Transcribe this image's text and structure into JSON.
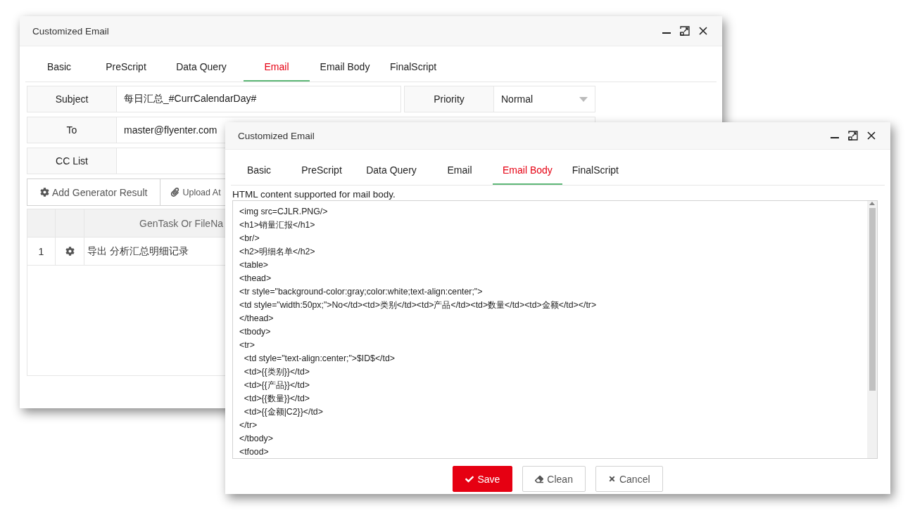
{
  "back_window": {
    "title": "Customized Email",
    "tabs": [
      {
        "label": "Basic",
        "selected": false
      },
      {
        "label": "PreScript",
        "selected": false
      },
      {
        "label": "Data Query",
        "selected": false
      },
      {
        "label": "Email",
        "selected": true
      },
      {
        "label": "Email Body",
        "selected": false
      },
      {
        "label": "FinalScript",
        "selected": false
      }
    ],
    "subject": {
      "label": "Subject",
      "value": "每日汇总_#CurrCalendarDay#"
    },
    "priority": {
      "label": "Priority",
      "value": "Normal"
    },
    "to": {
      "label": "To",
      "value": "master@flyenter.com"
    },
    "cc": {
      "label": "CC List"
    },
    "actions": [
      "Add Generator Result",
      "Upload At"
    ],
    "table": {
      "columns": [
        "GenTask Or FileNa"
      ],
      "rows": [
        {
          "index": "1",
          "name": "导出 分析汇总明细记录"
        }
      ]
    }
  },
  "front_window": {
    "title": "Customized Email",
    "tabs": [
      {
        "label": "Basic",
        "selected": false
      },
      {
        "label": "PreScript",
        "selected": false
      },
      {
        "label": "Data Query",
        "selected": false
      },
      {
        "label": "Email",
        "selected": false
      },
      {
        "label": "Email Body",
        "selected": true
      },
      {
        "label": "FinalScript",
        "selected": false
      }
    ],
    "hint": "HTML content supported for mail body.",
    "body_lines": [
      "<img src=CJLR.PNG/>",
      "<h1>销量汇报</h1>",
      "<br/>",
      "<h2>明细名单</h2>",
      "<table>",
      "<thead>",
      "<tr style=\"background-color:gray;color:white;text-align:center;\">",
      "<td style=\"width:50px;\">No</td><td>类别</td><td>产品</td><td>数量</td><td>金额</td></tr>",
      "</thead>",
      "<tbody>",
      "<tr>",
      "  <td style=\"text-align:center;\">$ID$</td>",
      "  <td>{{类别}}</td>",
      "  <td>{{产品}}</td>",
      "  <td>{{数量}}</td>",
      "  <td>{{金额|C2}}</td>",
      "</tr>",
      "</tbody>",
      "<tfood>"
    ],
    "buttons": [
      {
        "kind": "primary",
        "label": "Save"
      },
      {
        "kind": "clean",
        "label": "Clean"
      },
      {
        "kind": "cancel",
        "label": "Cancel"
      }
    ]
  }
}
